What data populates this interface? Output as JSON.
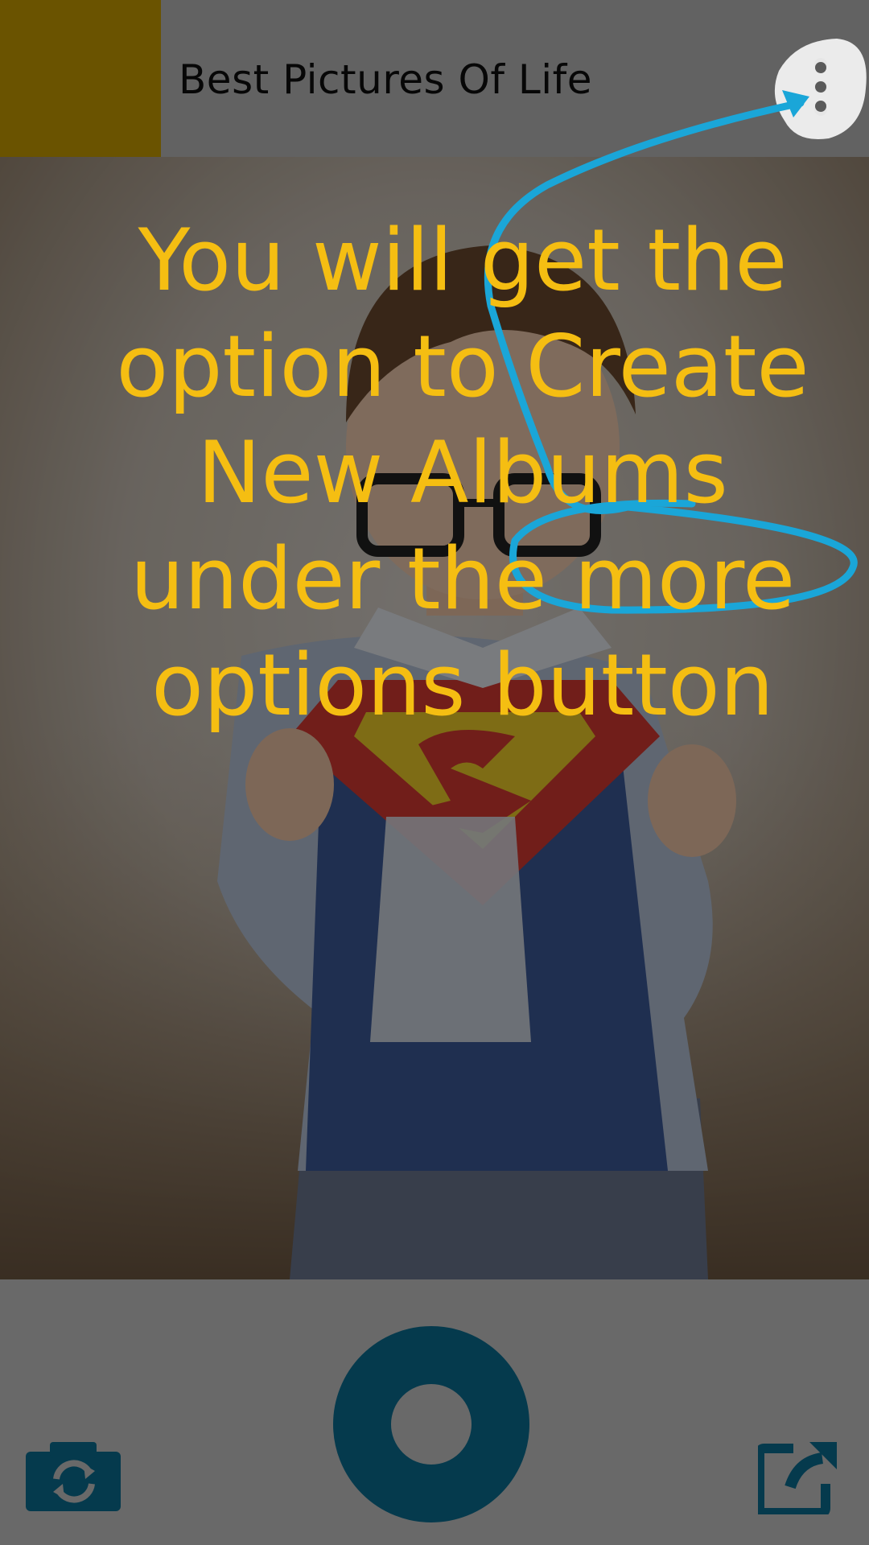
{
  "header": {
    "title": "Best Pictures Of Life",
    "logo_color": "#cc9f00",
    "more_icon": "more-vertical-icon"
  },
  "photo": {
    "subject": "photo-preview"
  },
  "bottom_bar": {
    "switch_camera_icon": "camera-switch-icon",
    "shutter_icon": "shutter-icon",
    "share_icon": "share-external-icon",
    "accent_color": "#0a6f94"
  },
  "tutorial": {
    "message": "You will get the option to Create New Albums under the more options button",
    "text_color": "#f5be12",
    "arrow_color": "#1aa6d8"
  }
}
